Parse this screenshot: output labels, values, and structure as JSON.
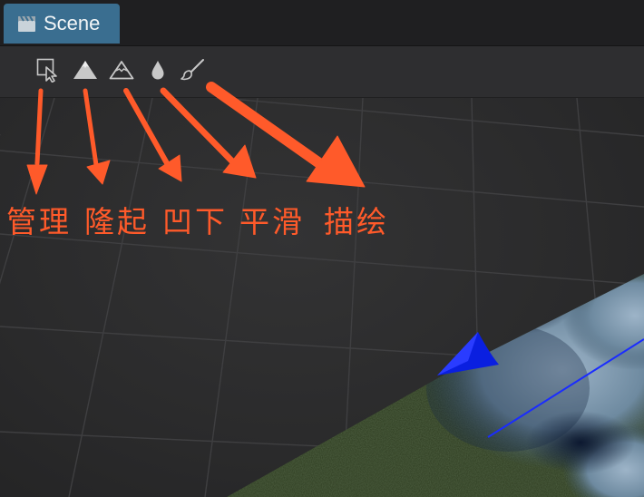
{
  "panel": {
    "tab_label": "Scene",
    "tab_icon": "clapperboard-icon",
    "accent_color": "#3a6e90"
  },
  "toolbar": {
    "tools": [
      {
        "icon": "select-cursor-icon"
      },
      {
        "icon": "raise-mountain-icon"
      },
      {
        "icon": "lower-mountain-icon"
      },
      {
        "icon": "smooth-drop-icon"
      },
      {
        "icon": "paint-brush-icon"
      }
    ]
  },
  "annotations": {
    "color": "#ff5a2a",
    "labels": [
      "管理",
      "隆起",
      "凹下",
      "平滑",
      "描绘"
    ]
  }
}
